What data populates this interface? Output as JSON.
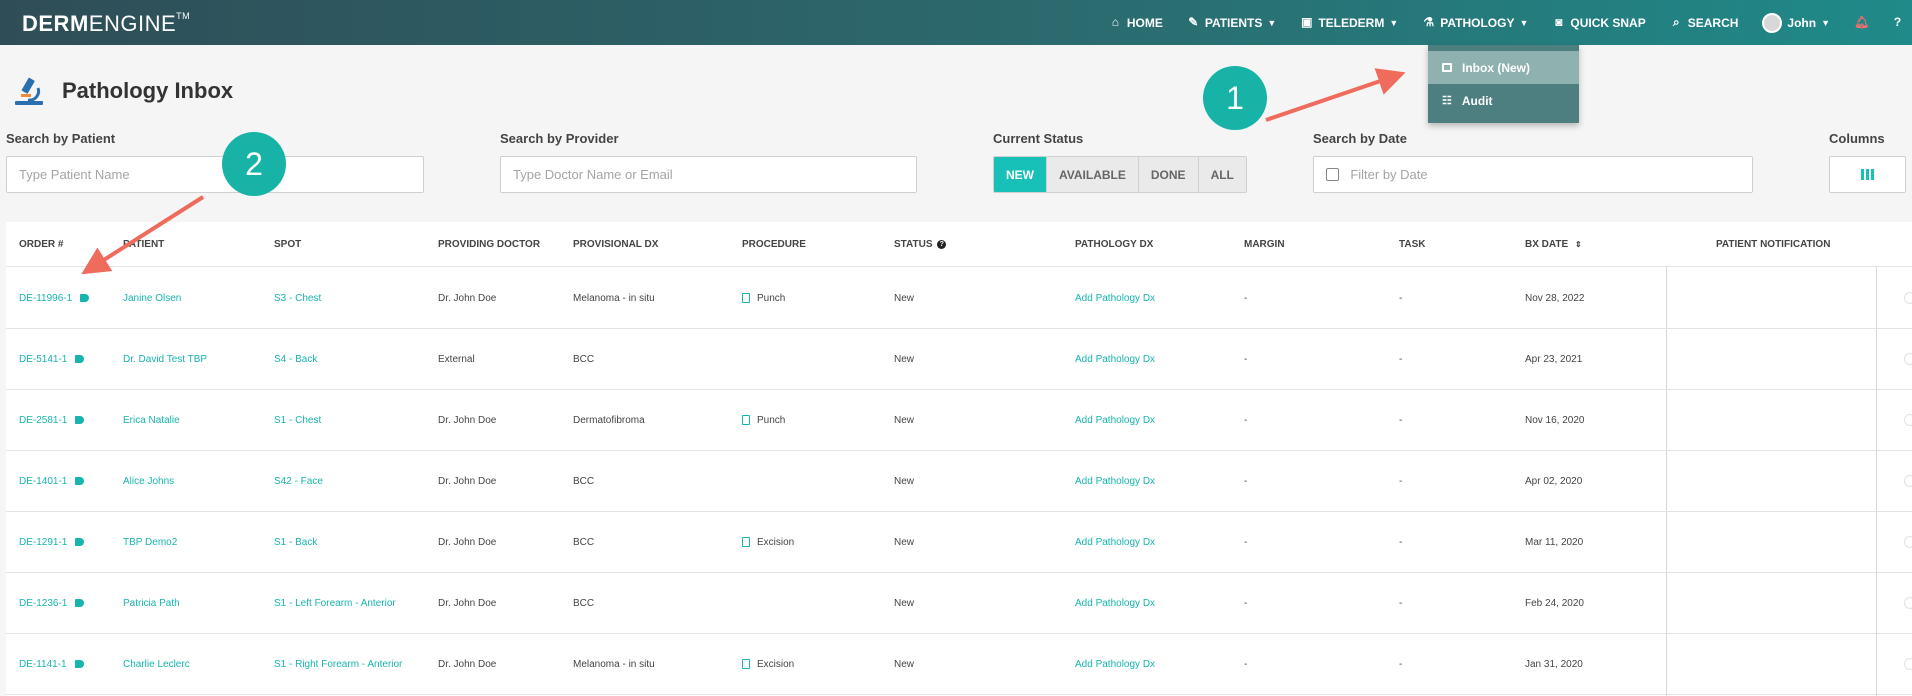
{
  "app": {
    "logo_derm": "DERM",
    "logo_engine": "ENGINE",
    "logo_tm": "TM"
  },
  "nav": {
    "home": "HOME",
    "patients": "PATIENTS",
    "telederm": "TELEDERM",
    "pathology": "PATHOLOGY",
    "quick_snap": "QUICK SNAP",
    "search": "SEARCH",
    "user": "John"
  },
  "pathology_menu": {
    "inbox": "Inbox (New)",
    "audit": "Audit"
  },
  "page": {
    "title": "Pathology Inbox"
  },
  "filters": {
    "patient_label": "Search by Patient",
    "patient_placeholder": "Type Patient Name",
    "provider_label": "Search by Provider",
    "provider_placeholder": "Type Doctor Name or Email",
    "status_label": "Current Status",
    "status_options": [
      "NEW",
      "AVAILABLE",
      "DONE",
      "ALL"
    ],
    "status_selected": "NEW",
    "date_label": "Search by Date",
    "date_placeholder": "Filter by Date",
    "columns_label": "Columns"
  },
  "table": {
    "headers": {
      "order": "ORDER #",
      "patient": "PATIENT",
      "spot": "SPOT",
      "providing_doctor": "PROVIDING DOCTOR",
      "provisional_dx": "PROVISIONAL DX",
      "procedure": "PROCEDURE",
      "status": "STATUS",
      "pathology_dx": "PATHOLOGY DX",
      "margin": "MARGIN",
      "task": "TASK",
      "bx_date": "BX DATE",
      "patient_notification": "PATIENT NOTIFICATION"
    },
    "rows": [
      {
        "order": "DE-11996-1",
        "patient": "Janine Olsen",
        "spot": "S3 - Chest",
        "doctor": "Dr. John Doe",
        "provisional_dx": "Melanoma - in situ",
        "procedure": "Punch",
        "status": "New",
        "pathology_dx": "Add Pathology Dx",
        "margin": "-",
        "task": "-",
        "bx_date": "Nov 28, 2022"
      },
      {
        "order": "DE-5141-1",
        "patient": "Dr. David Test TBP",
        "spot": "S4 - Back",
        "doctor": "External",
        "provisional_dx": "BCC",
        "procedure": "",
        "status": "New",
        "pathology_dx": "Add Pathology Dx",
        "margin": "-",
        "task": "-",
        "bx_date": "Apr 23, 2021"
      },
      {
        "order": "DE-2581-1",
        "patient": "Erica Natalie",
        "spot": "S1 - Chest",
        "doctor": "Dr. John Doe",
        "provisional_dx": "Dermatofibroma",
        "procedure": "Punch",
        "status": "New",
        "pathology_dx": "Add Pathology Dx",
        "margin": "-",
        "task": "-",
        "bx_date": "Nov 16, 2020"
      },
      {
        "order": "DE-1401-1",
        "patient": "Alice Johns",
        "spot": "S42 - Face",
        "doctor": "Dr. John Doe",
        "provisional_dx": "BCC",
        "procedure": "",
        "status": "New",
        "pathology_dx": "Add Pathology Dx",
        "margin": "-",
        "task": "-",
        "bx_date": "Apr 02, 2020"
      },
      {
        "order": "DE-1291-1",
        "patient": "TBP Demo2",
        "spot": "S1 - Back",
        "doctor": "Dr. John Doe",
        "provisional_dx": "BCC",
        "procedure": "Excision",
        "status": "New",
        "pathology_dx": "Add Pathology Dx",
        "margin": "-",
        "task": "-",
        "bx_date": "Mar 11, 2020"
      },
      {
        "order": "DE-1236-1",
        "patient": "Patricia Path",
        "spot": "S1 - Left Forearm - Anterior",
        "doctor": "Dr. John Doe",
        "provisional_dx": "BCC",
        "procedure": "",
        "status": "New",
        "pathology_dx": "Add Pathology Dx",
        "margin": "-",
        "task": "-",
        "bx_date": "Feb 24, 2020"
      },
      {
        "order": "DE-1141-1",
        "patient": "Charlie Leclerc",
        "spot": "S1 - Right Forearm - Anterior",
        "doctor": "Dr. John Doe",
        "provisional_dx": "Melanoma - in situ",
        "procedure": "Excision",
        "status": "New",
        "pathology_dx": "Add Pathology Dx",
        "margin": "-",
        "task": "-",
        "bx_date": "Jan 31, 2020"
      }
    ]
  },
  "annotations": {
    "callout_1": "1",
    "callout_2": "2"
  },
  "colors": {
    "accent": "#17c1b8",
    "header_dark": "#2f4d57",
    "callout": "#17b3a7",
    "arrow": "#ef6b5b"
  }
}
